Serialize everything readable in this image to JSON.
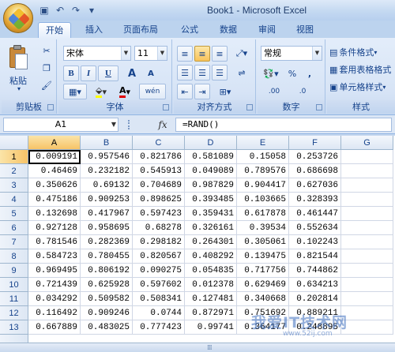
{
  "window": {
    "title": "Book1 - Microsoft Excel"
  },
  "qat": {
    "save_icon": "save-icon",
    "undo_icon": "undo-icon",
    "redo_icon": "redo-icon"
  },
  "tabs": [
    {
      "label": "开始"
    },
    {
      "label": "插入"
    },
    {
      "label": "页面布局"
    },
    {
      "label": "公式"
    },
    {
      "label": "数据"
    },
    {
      "label": "审阅"
    },
    {
      "label": "视图"
    }
  ],
  "ribbon": {
    "clipboard": {
      "label": "剪贴板",
      "paste": "粘贴"
    },
    "font": {
      "label": "字体",
      "name": "宋体",
      "size": "11",
      "bold": "B",
      "italic": "I",
      "underline": "U",
      "grow": "A",
      "shrink": "A",
      "color_a": "A",
      "phonetic": "wén"
    },
    "alignment": {
      "label": "对齐方式"
    },
    "number": {
      "label": "数字",
      "format": "常规",
      "percent": "%",
      "comma": ",",
      "inc_dec": ".00",
      "dec_dec": ".0"
    },
    "styles": {
      "label": "样式",
      "cond_format": "条件格式",
      "table_format": "套用表格格式",
      "cell_styles": "单元格样式"
    }
  },
  "formula_bar": {
    "name_box": "A1",
    "fx": "fx",
    "formula": "=RAND()"
  },
  "sheet": {
    "columns": [
      "A",
      "B",
      "C",
      "D",
      "E",
      "F",
      "G"
    ],
    "rows": [
      [
        "1",
        "0.009191",
        "0.957546",
        "0.821786",
        "0.581089",
        "0.15058",
        "0.253726"
      ],
      [
        "2",
        "0.46469",
        "0.232182",
        "0.545913",
        "0.049089",
        "0.789576",
        "0.686698"
      ],
      [
        "3",
        "0.350626",
        "0.69132",
        "0.704689",
        "0.987829",
        "0.904417",
        "0.627036"
      ],
      [
        "4",
        "0.475186",
        "0.909253",
        "0.898625",
        "0.393485",
        "0.103665",
        "0.328393"
      ],
      [
        "5",
        "0.132698",
        "0.417967",
        "0.597423",
        "0.359431",
        "0.617878",
        "0.461447"
      ],
      [
        "6",
        "0.927128",
        "0.958695",
        "0.68278",
        "0.326161",
        "0.39534",
        "0.552634"
      ],
      [
        "7",
        "0.781546",
        "0.282369",
        "0.298182",
        "0.264301",
        "0.305061",
        "0.102243"
      ],
      [
        "8",
        "0.584723",
        "0.780455",
        "0.820567",
        "0.408292",
        "0.139475",
        "0.821544"
      ],
      [
        "9",
        "0.969495",
        "0.806192",
        "0.090275",
        "0.054835",
        "0.717756",
        "0.744862"
      ],
      [
        "10",
        "0.721439",
        "0.625928",
        "0.597602",
        "0.012378",
        "0.629469",
        "0.634213"
      ],
      [
        "11",
        "0.034292",
        "0.509582",
        "0.508341",
        "0.127481",
        "0.340668",
        "0.202814"
      ],
      [
        "12",
        "0.116492",
        "0.909246",
        "0.0744",
        "0.872971",
        "0.751692",
        "0.889211"
      ],
      [
        "13",
        "0.667889",
        "0.483025",
        "0.777423",
        "0.99741",
        "0.364177",
        "0.248895"
      ]
    ]
  },
  "watermark": {
    "text": "我爱IT技术网",
    "sub": "www.52ij.com"
  },
  "bottombar": {
    "grip": "⁞⁞⁞"
  }
}
